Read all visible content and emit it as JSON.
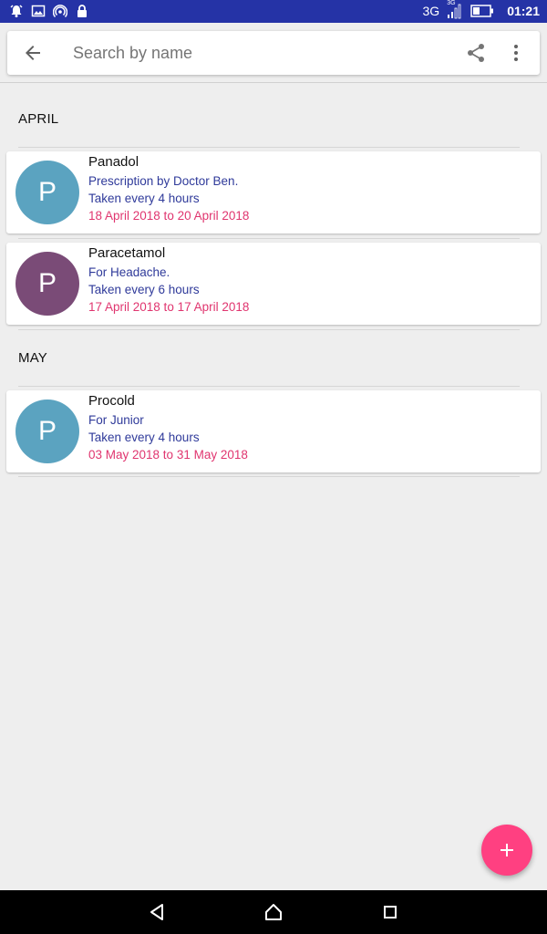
{
  "status_bar": {
    "network": "3G",
    "network_small": "3G",
    "time": "01:21",
    "left_icons": [
      "alarm-icon",
      "image-icon",
      "hotspot-icon",
      "lock-icon"
    ],
    "bg_color": "#2533a6"
  },
  "search": {
    "placeholder": "Search by name",
    "value": ""
  },
  "sections": [
    {
      "month": "APRIL",
      "items": [
        {
          "initial": "P",
          "avatar_color": "#5ba3c0",
          "name": "Panadol",
          "note": "Prescription by Doctor Ben.",
          "frequency": "Taken every 4 hours",
          "dates": "18 April 2018 to 20 April 2018"
        },
        {
          "initial": "P",
          "avatar_color": "#7a4b77",
          "name": "Paracetamol",
          "note": "For Headache.",
          "frequency": "Taken every 6 hours",
          "dates": "17 April 2018 to 17 April 2018"
        }
      ]
    },
    {
      "month": "MAY",
      "items": [
        {
          "initial": "P",
          "avatar_color": "#5ba3c0",
          "name": "Procold",
          "note": "For Junior",
          "frequency": "Taken every 4 hours",
          "dates": "03 May 2018 to 31 May 2018"
        }
      ]
    }
  ],
  "fab": {
    "icon": "plus-icon",
    "color": "#ff4081"
  },
  "colors": {
    "note_text": "#2f3a9a",
    "date_text": "#e0356f"
  }
}
